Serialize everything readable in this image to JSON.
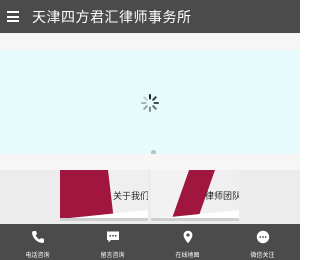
{
  "header": {
    "title": "天津四方君汇律师事务所",
    "menu_icon": "menu-icon"
  },
  "slider": {
    "loading_icon": "spinner-icon"
  },
  "cards": [
    {
      "label": "关于我们",
      "accent": "#a0163f"
    },
    {
      "label": "律师团队",
      "accent": "#a0163f"
    }
  ],
  "footer": {
    "items": [
      {
        "label": "电话咨询",
        "icon": "phone-icon"
      },
      {
        "label": "留言咨询",
        "icon": "message-icon"
      },
      {
        "label": "在线地图",
        "icon": "map-pin-icon"
      },
      {
        "label": "微信关注",
        "icon": "wechat-icon"
      }
    ]
  },
  "colors": {
    "header_bg": "#4b4b4b",
    "slider_bg": "#e6fbfb",
    "accent": "#a0163f"
  }
}
